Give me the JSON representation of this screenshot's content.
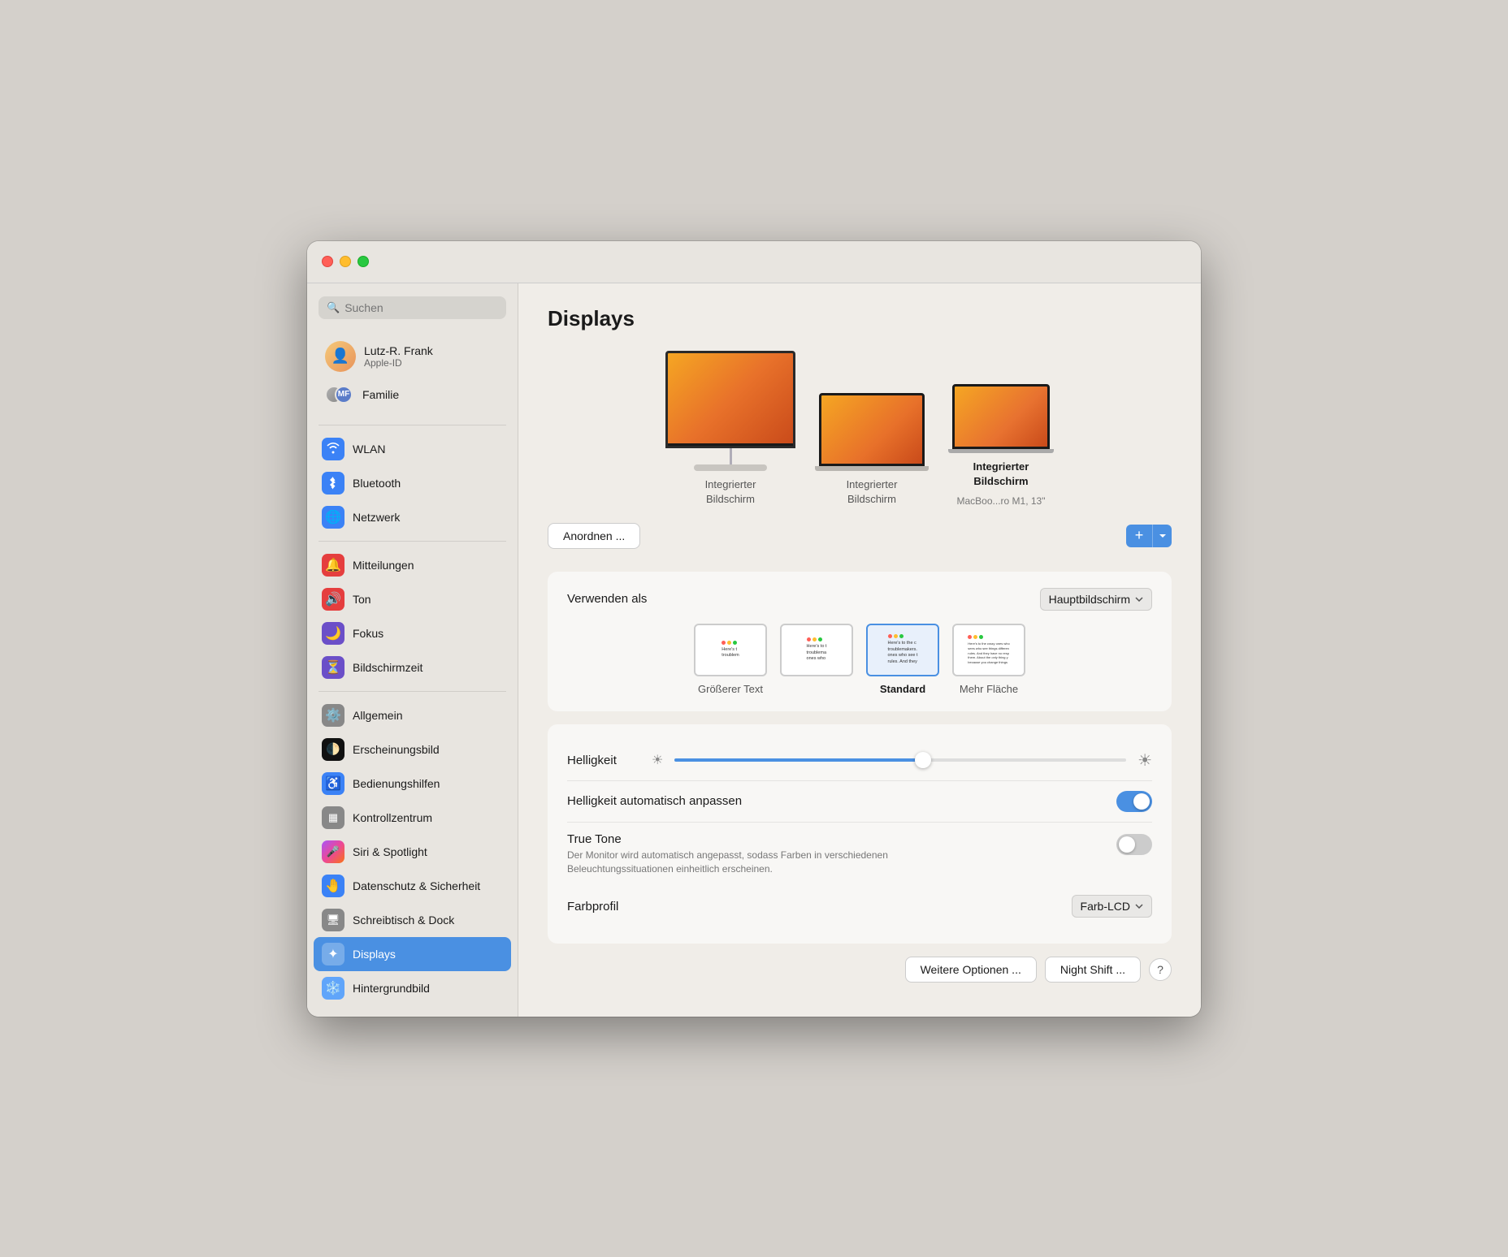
{
  "window": {
    "title": "Displays"
  },
  "titlebar": {
    "close": "close",
    "minimize": "minimize",
    "maximize": "maximize"
  },
  "sidebar": {
    "search_placeholder": "Suchen",
    "user": {
      "name": "Lutz-R. Frank",
      "subtitle": "Apple-ID"
    },
    "family_label": "Familie",
    "items": [
      {
        "id": "wlan",
        "label": "WLAN",
        "icon": "wifi"
      },
      {
        "id": "bluetooth",
        "label": "Bluetooth",
        "icon": "bluetooth"
      },
      {
        "id": "netzwerk",
        "label": "Netzwerk",
        "icon": "globe"
      },
      {
        "id": "mitteilungen",
        "label": "Mitteilungen",
        "icon": "bell"
      },
      {
        "id": "ton",
        "label": "Ton",
        "icon": "speaker"
      },
      {
        "id": "fokus",
        "label": "Fokus",
        "icon": "moon"
      },
      {
        "id": "bildschirmzeit",
        "label": "Bildschirmzeit",
        "icon": "hourglass"
      },
      {
        "id": "allgemein",
        "label": "Allgemein",
        "icon": "gear"
      },
      {
        "id": "erscheinungsbild",
        "label": "Erscheinungsbild",
        "icon": "appearance"
      },
      {
        "id": "bedienungshilfen",
        "label": "Bedienungshilfen",
        "icon": "accessibility"
      },
      {
        "id": "kontrollzentrum",
        "label": "Kontrollzentrum",
        "icon": "controlcenter"
      },
      {
        "id": "siri",
        "label": "Siri & Spotlight",
        "icon": "siri"
      },
      {
        "id": "datenschutz",
        "label": "Datenschutz & Sicherheit",
        "icon": "hand"
      },
      {
        "id": "schreibtisch",
        "label": "Schreibtisch & Dock",
        "icon": "desktop"
      },
      {
        "id": "displays",
        "label": "Displays",
        "icon": "display",
        "active": true
      },
      {
        "id": "hintergrundbild",
        "label": "Hintergrundbild",
        "icon": "photo"
      }
    ]
  },
  "main": {
    "title": "Displays",
    "displays": [
      {
        "type": "imac",
        "label": "Integrierter\nBildschirm",
        "bold": false
      },
      {
        "type": "laptop",
        "label": "Integrierter\nBildschirm",
        "bold": false
      },
      {
        "type": "macbook",
        "label": "Integrierter\nBildschirm",
        "bold": true,
        "sub": "MacBoo...ro M1, 13\""
      }
    ],
    "arrange_btn": "Anordnen ...",
    "verwenden_als_label": "Verwenden als",
    "hauptbildschirm": "Hauptbildschirm",
    "resolution_options": [
      {
        "id": "groesser",
        "label": "Größerer Text",
        "selected": false
      },
      {
        "id": "medium1",
        "label": "",
        "selected": false
      },
      {
        "id": "standard",
        "label": "Standard",
        "selected": true
      },
      {
        "id": "mehr_flaeche",
        "label": "Mehr Fläche",
        "selected": false
      }
    ],
    "helligkeit_label": "Helligkeit",
    "helligkeit_auto_label": "Helligkeit automatisch anpassen",
    "helligkeit_auto_on": true,
    "true_tone_label": "True Tone",
    "true_tone_sub": "Der Monitor wird automatisch angepasst, sodass Farben in verschiedenen Beleuchtungssituationen einheitlich erscheinen.",
    "true_tone_on": false,
    "farbprofil_label": "Farbprofil",
    "farbprofil_value": "Farb-LCD",
    "weitere_optionen_btn": "Weitere Optionen ...",
    "night_shift_btn": "Night Shift ...",
    "help_btn": "?"
  }
}
